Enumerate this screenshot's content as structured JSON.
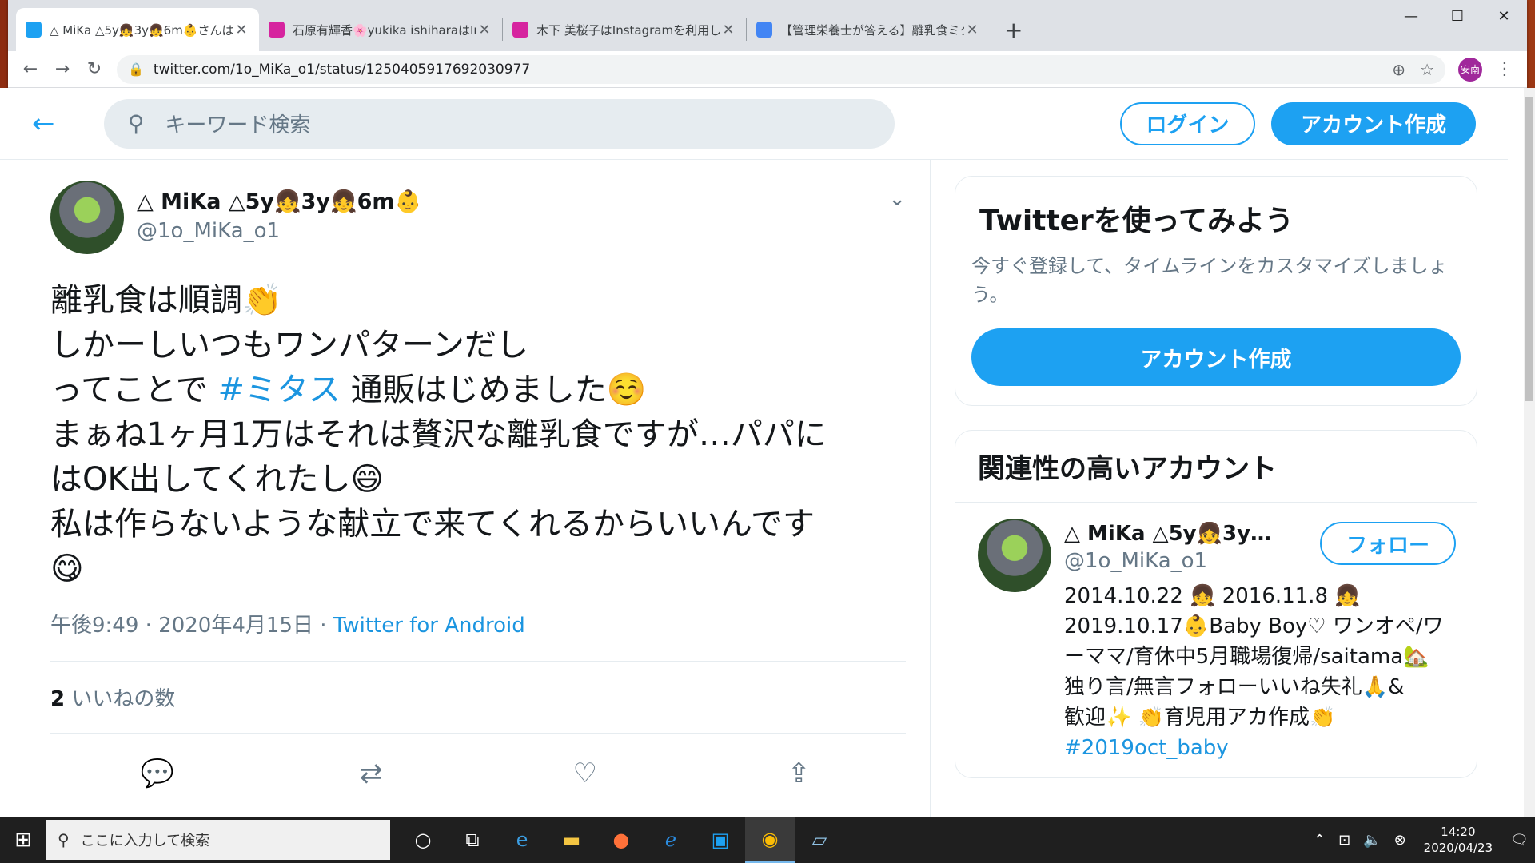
{
  "tabs": [
    {
      "title": "△ MiKa △5y👧3y👧6m👶さんは",
      "favicon_color": "#1da1f2",
      "active": true
    },
    {
      "title": "石原有輝香🌸yukika ishiharaはIn",
      "favicon_color": "#d6249f",
      "active": false
    },
    {
      "title": "木下 美桜子はInstagramを利用して",
      "favicon_color": "#d6249f",
      "active": false
    },
    {
      "title": "【管理栄養士が答える】離乳食ミタス",
      "favicon_color": "#4285f4",
      "active": false
    }
  ],
  "window_controls": {
    "minimize": "—",
    "maximize": "☐",
    "close": "✕"
  },
  "address_bar": {
    "url": "twitter.com/1o_MiKa_o1/status/1250405917692030977",
    "profile_label": "安南"
  },
  "header": {
    "search_placeholder": "キーワード検索",
    "login_label": "ログイン",
    "signup_label": "アカウント作成"
  },
  "tweet": {
    "display_name": "△ MiKa △5y👧3y👧6m👶",
    "handle": "@1o_MiKa_o1",
    "lines": [
      "離乳食は順調👏",
      "しかーしいつもワンパターンだし",
      "ってことで",
      "#ミタス",
      "通販はじめました☺️",
      "まぁね1ヶ月1万はそれは贅沢な離乳食ですが…パパに",
      "はOK出してくれたし😄",
      "私は作らないような献立で来てくれるからいいんです",
      "😋"
    ],
    "time": "午後9:49 · 2020年4月15日 · ",
    "source": "Twitter for Android",
    "likes_count": "2",
    "likes_label": "いいねの数"
  },
  "sidebar": {
    "card1": {
      "title": "Twitterを使ってみよう",
      "desc": "今すぐ登録して、タイムラインをカスタマイズしましょう。",
      "button": "アカウント作成"
    },
    "card2": {
      "title": "関連性の高いアカウント",
      "account": {
        "name": "△ MiKa △5y👧3y…",
        "handle": "@1o_MiKa_o1",
        "follow_label": "フォロー",
        "bio_lines": [
          "2014.10.22 👧 2016.11.8 👧",
          "2019.10.17👶Baby Boy♡ ワンオペ/ワ",
          "ーママ/育休中5月職場復帰/saitama🏡",
          "独り言/無言フォローいいね失礼🙏&",
          "歓迎✨ 👏育児用アカ作成👏"
        ],
        "bio_hashtag": "#2019oct_baby"
      }
    }
  },
  "taskbar": {
    "search_text": "ここに入力して検索",
    "time": "14:20",
    "date": "2020/04/23"
  }
}
